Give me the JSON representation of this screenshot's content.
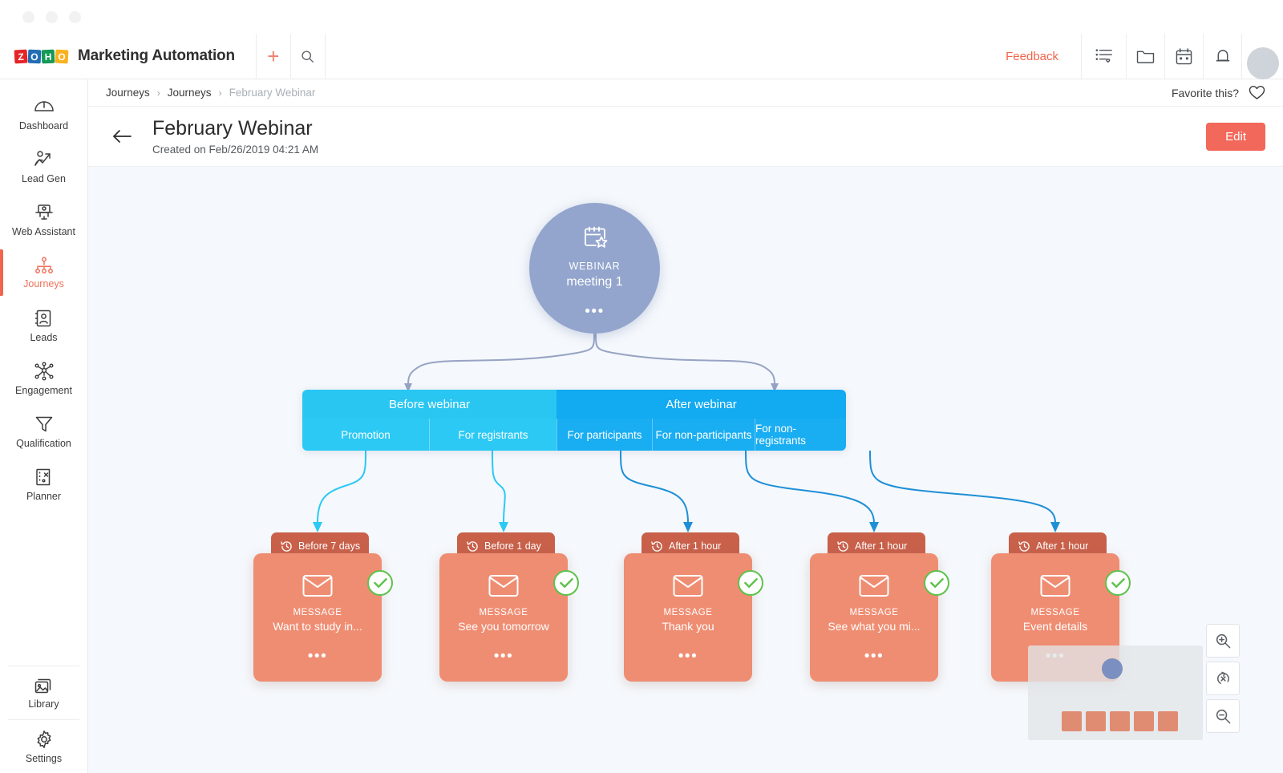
{
  "window": {
    "dots": [
      "close",
      "minimize",
      "maximize"
    ]
  },
  "topbar": {
    "brand": "Marketing Automation",
    "logo_letters": [
      "Z",
      "O",
      "H",
      "O"
    ],
    "add_icon": "plus-icon",
    "search_icon": "search-icon",
    "feedback_label": "Feedback",
    "icons": [
      "list-heart-icon",
      "folder-icon",
      "calendar-icon",
      "bell-icon",
      "support-avatar"
    ]
  },
  "sidebar": {
    "items": [
      {
        "label": "Dashboard",
        "icon": "dashboard-icon",
        "active": false
      },
      {
        "label": "Lead Gen",
        "icon": "lead-gen-icon",
        "active": false
      },
      {
        "label": "Web Assistant",
        "icon": "web-assistant-icon",
        "active": false
      },
      {
        "label": "Journeys",
        "icon": "journeys-icon",
        "active": true
      },
      {
        "label": "Leads",
        "icon": "leads-icon",
        "active": false
      },
      {
        "label": "Engagement",
        "icon": "engagement-icon",
        "active": false
      },
      {
        "label": "Qualification",
        "icon": "qualification-icon",
        "active": false
      },
      {
        "label": "Planner",
        "icon": "planner-icon",
        "active": false
      }
    ],
    "bottom_items": [
      {
        "label": "Library",
        "icon": "library-icon"
      },
      {
        "label": "Settings",
        "icon": "gear-icon"
      }
    ]
  },
  "breadcrumb": {
    "items": [
      "Journeys",
      "Journeys",
      "February Webinar"
    ],
    "separator": "›",
    "favorite_label": "Favorite this?",
    "favorite_icon": "heart-icon"
  },
  "page": {
    "back_icon": "back-arrow-icon",
    "title": "February Webinar",
    "subtitle": "Created on Feb/26/2019 04:21 AM",
    "edit_label": "Edit"
  },
  "journey": {
    "root_node": {
      "kind": "WEBINAR",
      "title": "meeting 1",
      "icon": "calendar-star-icon",
      "menu": "•••",
      "color": "#93a5cd"
    },
    "tab_groups": [
      {
        "label": "Before webinar",
        "color": "#29c6f2",
        "tabs": [
          {
            "label": "Promotion"
          },
          {
            "label": "For registrants"
          }
        ]
      },
      {
        "label": "After webinar",
        "color": "#12aaf0",
        "tabs": [
          {
            "label": "For participants"
          },
          {
            "label": "For non-participants"
          },
          {
            "label": "For non-registrants"
          }
        ]
      }
    ],
    "cards": [
      {
        "timing": "Before 7 days",
        "kind": "MESSAGE",
        "title": "Want to study in...",
        "status": "done"
      },
      {
        "timing": "Before 1 day",
        "kind": "MESSAGE",
        "title": "See you tomorrow",
        "status": "done"
      },
      {
        "timing": "After 1 hour",
        "kind": "MESSAGE",
        "title": "Thank you",
        "status": "done"
      },
      {
        "timing": "After 1 hour",
        "kind": "MESSAGE",
        "title": "See what you mi...",
        "status": "done"
      },
      {
        "timing": "After 1 hour",
        "kind": "MESSAGE",
        "title": "Event details",
        "status": "done"
      }
    ],
    "card_menu": "•••",
    "clock_icon": "clock-icon",
    "envelope_icon": "envelope-icon",
    "check_icon": "check-circle-icon",
    "colors": {
      "canvas_bg": "#f5f8fc",
      "card_body": "#ef8d72",
      "card_tab": "#c9604a",
      "check_green": "#5ec24b",
      "connector_blue_gray": "#96a3c4",
      "connector_cyan": "#2bc9f4",
      "connector_blue": "#1e8fd6",
      "accent": "#f2685a"
    }
  },
  "minimap": {
    "node_count": 5,
    "root_marker": "webinar-node-marker"
  },
  "zoom_controls": [
    {
      "name": "zoom-in",
      "icon": "zoom-in-icon"
    },
    {
      "name": "reset-zoom",
      "icon": "reset-zoom-icon"
    },
    {
      "name": "zoom-out",
      "icon": "zoom-out-icon"
    }
  ]
}
